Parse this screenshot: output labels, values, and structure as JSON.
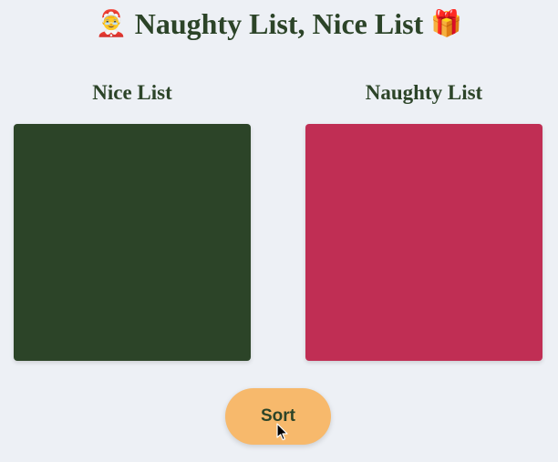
{
  "header": {
    "title": "Naughty List, Nice List",
    "left_emoji": "🤶",
    "right_emoji": "🎁"
  },
  "lists": {
    "nice": {
      "label": "Nice List",
      "color": "#2c4428"
    },
    "naughty": {
      "label": "Naughty List",
      "color": "#c02e54"
    }
  },
  "actions": {
    "sort_label": "Sort",
    "sort_color": "#f7b96c"
  },
  "theme": {
    "background": "#edf0f5",
    "text": "#2c4428"
  }
}
